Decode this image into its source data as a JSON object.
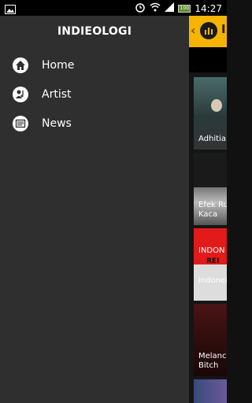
{
  "status_bar": {
    "time": "14:27",
    "battery": "100"
  },
  "drawer": {
    "title": "INDIEOLOGI",
    "items": [
      {
        "label": "Home",
        "icon": "home-icon"
      },
      {
        "label": "Artist",
        "icon": "artist-icon"
      },
      {
        "label": "News",
        "icon": "news-icon"
      }
    ]
  },
  "content": {
    "header_text": "I",
    "cards": [
      {
        "label_line1": "Adhitia",
        "label_line2": ""
      },
      {
        "label_line1": "Efek Ru",
        "label_line2": "Kaca"
      },
      {
        "label_line1": "INDON",
        "label_line2": "REI",
        "label_line3": "indonei"
      },
      {
        "label_line1": "Melanc",
        "label_line2": "Bitch"
      },
      {
        "label_line1": "",
        "label_line2": ""
      }
    ]
  },
  "colors": {
    "accent": "#f5b400",
    "drawer_bg": "#2f2f2f",
    "status_bg": "#000000"
  }
}
